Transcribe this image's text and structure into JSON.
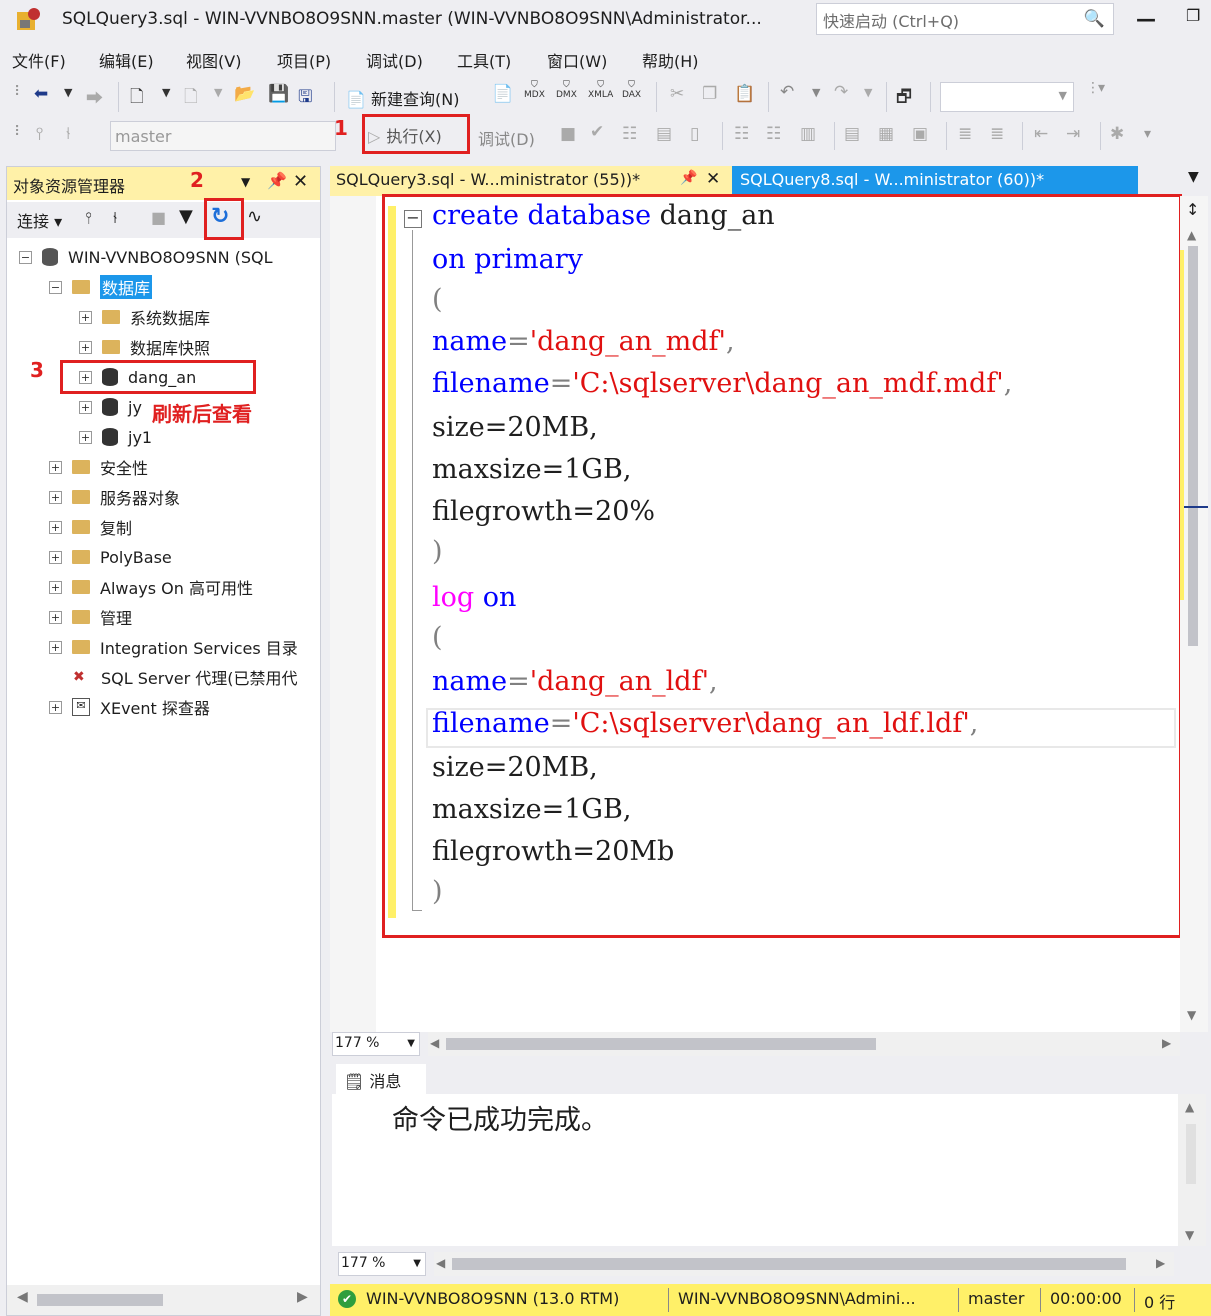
{
  "window": {
    "title": "SQLQuery3.sql - WIN-VVNBO8O9SNN.master (WIN-VVNBO8O9SNN\\Administrator...",
    "quick_launch_placeholder": "快速启动 (Ctrl+Q)"
  },
  "menu": [
    "文件(F)",
    "编辑(E)",
    "视图(V)",
    "项目(P)",
    "调试(D)",
    "工具(T)",
    "窗口(W)",
    "帮助(H)"
  ],
  "toolbar": {
    "new_query": "新建查询(N)",
    "database": "master",
    "execute": "执行(X)",
    "debug": "调试(D)",
    "mdx": "MDX",
    "dmx": "DMX",
    "xmla": "XMLA",
    "dax": "DAX"
  },
  "annotations": {
    "step1": "1",
    "step2": "2",
    "step3": "3",
    "refresh_note": "刷新后查看"
  },
  "object_explorer": {
    "title": "对象资源管理器",
    "connect": "连接",
    "server": "WIN-VVNBO8O9SNN (SQL",
    "nodes": [
      {
        "label": "数据库"
      },
      {
        "label": "系统数据库"
      },
      {
        "label": "数据库快照"
      },
      {
        "label": "dang_an"
      },
      {
        "label": "jy"
      },
      {
        "label": "jy1"
      },
      {
        "label": "安全性"
      },
      {
        "label": "服务器对象"
      },
      {
        "label": "复制"
      },
      {
        "label": "PolyBase"
      },
      {
        "label": "Always On 高可用性"
      },
      {
        "label": "管理"
      },
      {
        "label": "Integration Services 目录"
      },
      {
        "label": "SQL Server 代理(已禁用代"
      },
      {
        "label": "XEvent 探查器"
      }
    ]
  },
  "tabs": {
    "active": "SQLQuery3.sql - W...ministrator (55))*",
    "second": "SQLQuery8.sql - W...ministrator (60))*"
  },
  "code": {
    "l1_kw": "create database",
    "l1_name": " dang_an",
    "l2": "on primary",
    "l3": "(",
    "l4_kw": "name",
    "l4_eq": "=",
    "l4_str": "'dang_an_mdf'",
    "l4_c": ",",
    "l5_kw": "filename",
    "l5_eq": "=",
    "l5_str": "'C:\\sqlserver\\dang_an_mdf.mdf'",
    "l5_c": ",",
    "l6": "size=20MB,",
    "l7": "maxsize=1GB,",
    "l8": "filegrowth=20%",
    "l9": " )",
    "l10_kw": "log",
    "l10_b": " on",
    "l11": "(",
    "l12_kw": "name",
    "l12_eq": "=",
    "l12_str": "'dang_an_ldf'",
    "l12_c": ",",
    "l13_kw": "filename",
    "l13_eq": "=",
    "l13_str": "'C:\\sqlserver\\dang_an_ldf.ldf'",
    "l13_c": ",",
    "l14": "size=20MB,",
    "l15": "maxsize=1GB,",
    "l16": "filegrowth=20Mb",
    "l17": " )"
  },
  "editor_zoom": "177 %",
  "messages": {
    "tab_label": "消息",
    "text": "命令已成功完成。",
    "zoom": "177 %"
  },
  "status": {
    "server": "WIN-VVNBO8O9SNN (13.0 RTM)",
    "user": "WIN-VVNBO8O9SNN\\Admini...",
    "database": "master",
    "time": "00:00:00",
    "rows": "0 行"
  }
}
